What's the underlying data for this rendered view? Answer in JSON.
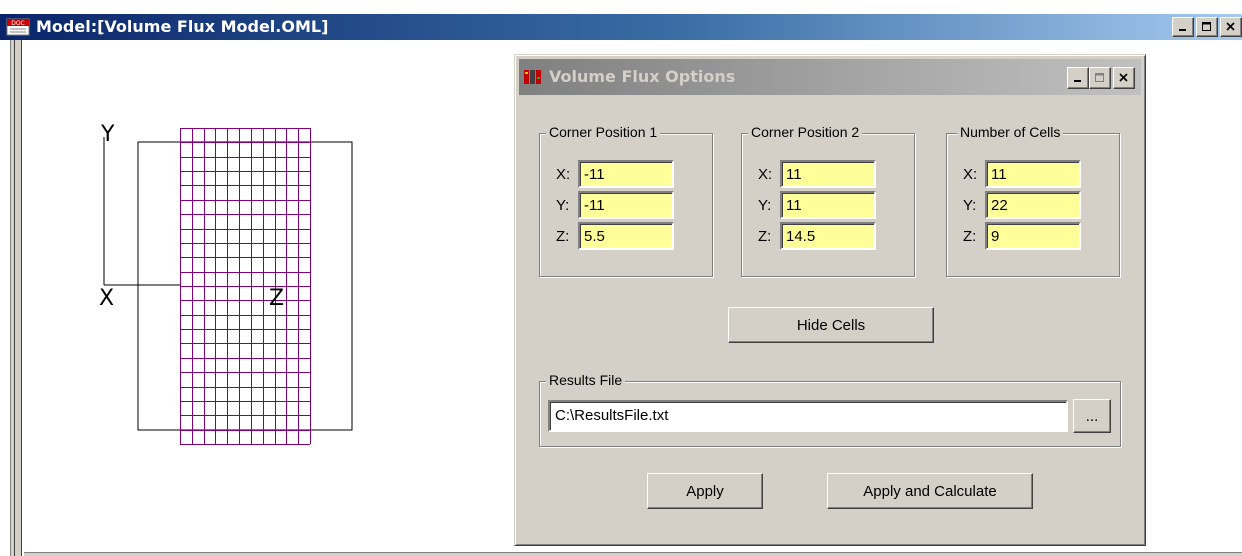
{
  "window": {
    "title": "Model:[Volume Flux Model.OML]",
    "doc_icon_text": "DOC",
    "controls": [
      "minimize",
      "maximize",
      "close"
    ]
  },
  "canvas": {
    "axis_labels": {
      "y": "Y",
      "x": "X",
      "z": "Z"
    },
    "grid_color": "#800080",
    "grid_columns": 11,
    "grid_rows": 22
  },
  "dialog": {
    "title": "Volume Flux Options",
    "groups": [
      {
        "label": "Corner Position 1",
        "fields": [
          {
            "axis": "X:",
            "value": "-11"
          },
          {
            "axis": "Y:",
            "value": "-11"
          },
          {
            "axis": "Z:",
            "value": "5.5"
          }
        ]
      },
      {
        "label": "Corner Position 2",
        "fields": [
          {
            "axis": "X:",
            "value": "11"
          },
          {
            "axis": "Y:",
            "value": "11"
          },
          {
            "axis": "Z:",
            "value": "14.5"
          }
        ]
      },
      {
        "label": "Number of Cells",
        "fields": [
          {
            "axis": "X:",
            "value": "11"
          },
          {
            "axis": "Y:",
            "value": "22"
          },
          {
            "axis": "Z:",
            "value": "9"
          }
        ]
      }
    ],
    "hide_cells_label": "Hide Cells",
    "results": {
      "label": "Results File",
      "value": "C:\\ResultsFile.txt",
      "browse_label": "..."
    },
    "apply_label": "Apply",
    "apply_calc_label": "Apply and Calculate"
  },
  "colors": {
    "field_bg": "#ffff99",
    "dialog_bg": "#d4d0c8",
    "active_title": "#0a246a",
    "inactive_title": "#808080"
  }
}
